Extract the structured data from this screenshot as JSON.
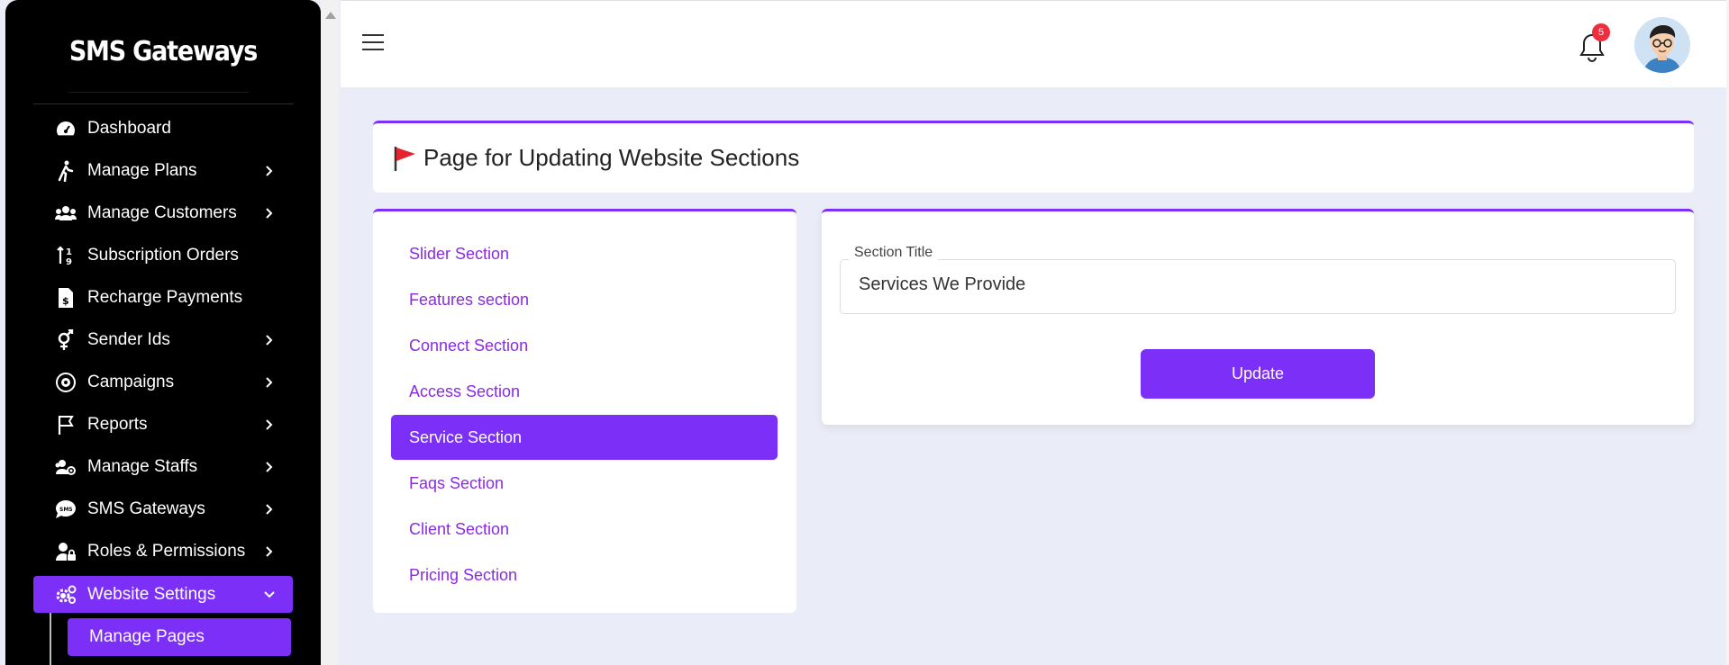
{
  "sidebar": {
    "brand": "SMS Gateways",
    "items": [
      {
        "label": "Dashboard",
        "icon": "dashboard-icon",
        "chevron": false
      },
      {
        "label": "Manage Plans",
        "icon": "walking-icon",
        "chevron": true
      },
      {
        "label": "Manage Customers",
        "icon": "users-icon",
        "chevron": true
      },
      {
        "label": "Subscription Orders",
        "icon": "sort-icon",
        "chevron": false
      },
      {
        "label": "Recharge Payments",
        "icon": "invoice-dollar-icon",
        "chevron": false
      },
      {
        "label": "Sender Ids",
        "icon": "gender-icon",
        "chevron": true
      },
      {
        "label": "Campaigns",
        "icon": "campaign-icon",
        "chevron": true
      },
      {
        "label": "Reports",
        "icon": "flag-icon",
        "chevron": true
      },
      {
        "label": "Manage Staffs",
        "icon": "staff-icon",
        "chevron": true
      },
      {
        "label": "SMS Gateways",
        "icon": "sms-icon",
        "chevron": true
      },
      {
        "label": "Roles & Permissions",
        "icon": "user-lock-icon",
        "chevron": true
      },
      {
        "label": "Website Settings",
        "icon": "gears-icon",
        "chevron": true,
        "expanded": true
      }
    ],
    "sub_item": "Manage Pages"
  },
  "header": {
    "notification_count": "5"
  },
  "page": {
    "title": "Page for Updating Website Sections"
  },
  "sections": [
    {
      "label": "Slider Section"
    },
    {
      "label": "Features section"
    },
    {
      "label": "Connect Section"
    },
    {
      "label": "Access Section"
    },
    {
      "label": "Service Section",
      "active": true
    },
    {
      "label": "Faqs Section"
    },
    {
      "label": "Client Section"
    },
    {
      "label": "Pricing Section"
    }
  ],
  "form": {
    "section_title_label": "Section Title",
    "section_title_value": "Services We Provide",
    "update_label": "Update"
  },
  "colors": {
    "accent": "#7b2ff7",
    "link": "#8a2be2",
    "badge": "#ef2d3c"
  }
}
